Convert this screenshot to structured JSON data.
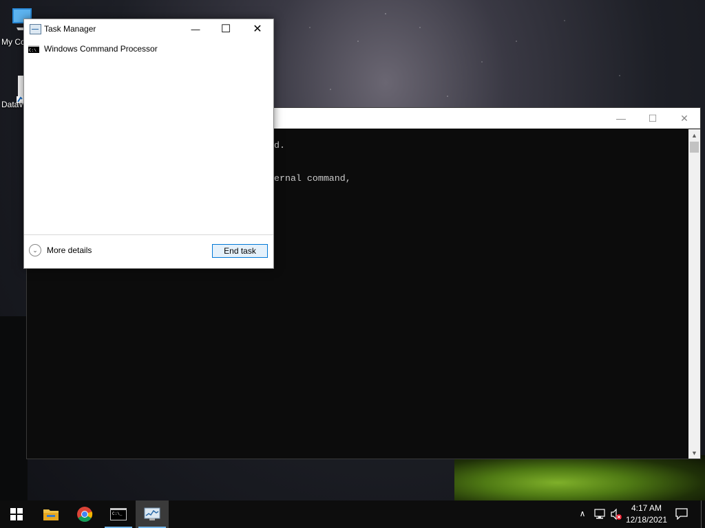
{
  "desktop": {
    "icons": [
      {
        "label": "My Co"
      },
      {
        "label": "DataW"
      }
    ]
  },
  "cmd_window": {
    "lines": [
      "d.",
      "ernal command,"
    ],
    "controls": {
      "minimize": "—",
      "maximize": "☐",
      "close": "✕"
    }
  },
  "task_manager": {
    "title": "Task Manager",
    "controls": {
      "minimize": "—",
      "maximize": "☐",
      "close": "✕"
    },
    "processes": [
      {
        "name": "Windows Command Processor",
        "icon": "cmd-icon"
      }
    ],
    "more_details": "More details",
    "end_task": "End task"
  },
  "taskbar": {
    "apps": [
      {
        "name": "start-button",
        "icon": "windows-logo-icon"
      },
      {
        "name": "file-explorer",
        "icon": "folder-icon"
      },
      {
        "name": "chrome",
        "icon": "chrome-icon"
      },
      {
        "name": "cmd",
        "icon": "cmd-icon"
      },
      {
        "name": "task-manager",
        "icon": "task-manager-icon"
      }
    ],
    "tray": {
      "time": "4:17 AM",
      "date": "12/18/2021"
    }
  },
  "colors": {
    "accent": "#0078d7",
    "taskbar": "#0d0d0d",
    "cmd_bg": "#0c0c0c"
  }
}
